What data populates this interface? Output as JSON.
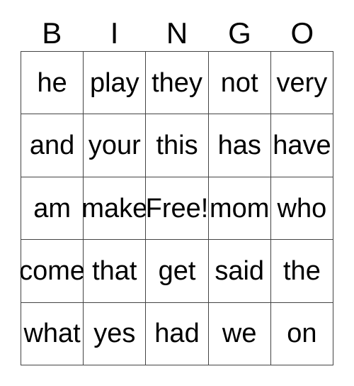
{
  "card": {
    "title": "BINGO",
    "header_letters": [
      "B",
      "I",
      "N",
      "G",
      "O"
    ],
    "colors": {
      "background": "#ffffff",
      "text": "#000000",
      "border": "#444444"
    },
    "grid": {
      "rows": 5,
      "columns": 5,
      "free_space": "Free!",
      "cells": [
        [
          "he",
          "play",
          "they",
          "not",
          "very"
        ],
        [
          "and",
          "your",
          "this",
          "has",
          "have"
        ],
        [
          "am",
          "make",
          "Free!",
          "mom",
          "who"
        ],
        [
          "come",
          "that",
          "get",
          "said",
          "the"
        ],
        [
          "what",
          "yes",
          "had",
          "we",
          "on"
        ]
      ]
    }
  }
}
